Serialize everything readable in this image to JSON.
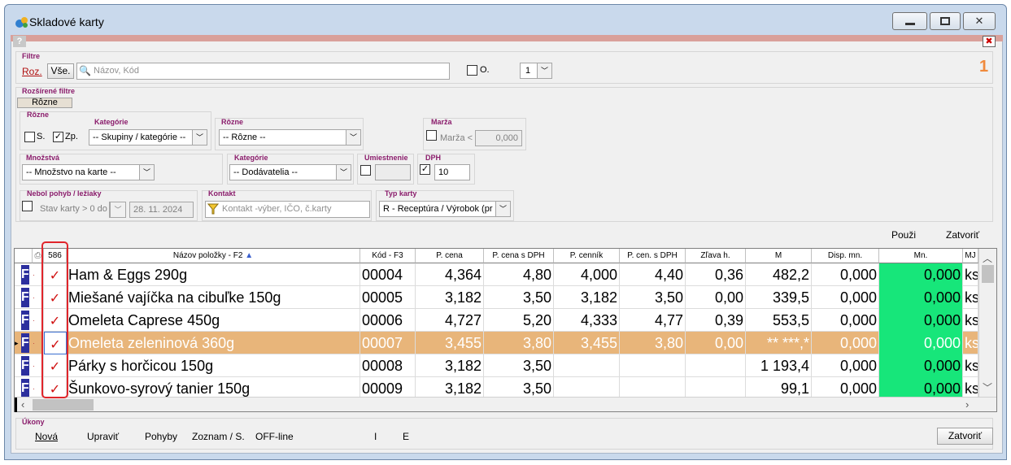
{
  "window": {
    "title": "Skladové karty"
  },
  "filters": {
    "label": "Filtre",
    "roz": "Roz.",
    "vse": "Vše.",
    "search_placeholder": "Názov, Kód",
    "o_label": "O.",
    "page_select": "1",
    "badge": "1"
  },
  "extended": {
    "label": "Rozšírené filtre",
    "tab": "Rôzne",
    "rozne_group": "Rôzne",
    "s_label": "S.",
    "zp_label": "Zp.",
    "kategorie1_label": "Kategórie",
    "kategorie1_value": "-- Skupiny / kategórie --",
    "rozne2_label": "Rôzne",
    "rozne2_value": "-- Rôzne --",
    "marza_label": "Marža",
    "marza_text": "Marža <",
    "marza_value": "0,000",
    "mnozstvo_label": "Množstvá",
    "mnozstvo_value": "-- Množstvo na karte --",
    "kategorie2_label": "Kategórie",
    "kategorie2_value": "-- Dodávatelia --",
    "umiestnenie_label": "Umiestnenie",
    "dph_label": "DPH",
    "dph_value": "10",
    "nebol_label": "Nebol pohyb / ležiaky",
    "stav_text": "Stav karty > 0 do",
    "date_value": "28. 11. 2024",
    "kontakt_label": "Kontakt",
    "kontakt_placeholder": "Kontakt -výber, IČO, č.karty",
    "typ_label": "Typ karty",
    "typ_value": "R - Receptúra / Výrobok (pr",
    "pouzi": "Použi",
    "zatvorit": "Zatvoriť"
  },
  "grid": {
    "headers": {
      "count": "586",
      "nazov": "Názov položky - F2",
      "kod": "Kód - F3",
      "pcena": "P. cena",
      "pcena_dph": "P. cena s DPH",
      "pcennik": "P. cenník",
      "pcen_dph": "P. cen. s DPH",
      "zlava": "Zľava h.",
      "m": "M",
      "disp": "Disp. mn.",
      "mn": "Mn.",
      "mj": "MJ"
    },
    "rows": [
      {
        "tag": "F",
        "name": "Ham & Eggs  290g",
        "kod": "00004",
        "pcena": "4,364",
        "pcena_dph": "4,80",
        "pcennik": "4,000",
        "pcen_dph": "4,40",
        "zlava": "0,36",
        "m": "482,2",
        "disp": "0,000",
        "mn": "0,000",
        "mj": "ks"
      },
      {
        "tag": "F",
        "name": "Miešané vajíčka na cibuľke 150g",
        "kod": "00005",
        "pcena": "3,182",
        "pcena_dph": "3,50",
        "pcennik": "3,182",
        "pcen_dph": "3,50",
        "zlava": "0,00",
        "m": "339,5",
        "disp": "0,000",
        "mn": "0,000",
        "mj": "ks"
      },
      {
        "tag": "F",
        "name": "Omeleta Caprese 450g",
        "kod": "00006",
        "pcena": "4,727",
        "pcena_dph": "5,20",
        "pcennik": "4,333",
        "pcen_dph": "4,77",
        "zlava": "0,39",
        "m": "553,5",
        "disp": "0,000",
        "mn": "0,000",
        "mj": "ks"
      },
      {
        "tag": "F",
        "name": "Omeleta zeleninová 360g",
        "kod": "00007",
        "pcena": "3,455",
        "pcena_dph": "3,80",
        "pcennik": "3,455",
        "pcen_dph": "3,80",
        "zlava": "0,00",
        "m": "** ***,*",
        "disp": "0,000",
        "mn": "0,000",
        "mj": "ks"
      },
      {
        "tag": "F",
        "name": "Párky s horčicou 150g",
        "kod": "00008",
        "pcena": "3,182",
        "pcena_dph": "3,50",
        "pcennik": "",
        "pcen_dph": "",
        "zlava": "",
        "m": "1 193,4",
        "disp": "0,000",
        "mn": "0,000",
        "mj": "ks"
      },
      {
        "tag": "F",
        "name": "Šunkovo-syrový tanier 150g",
        "kod": "00009",
        "pcena": "3,182",
        "pcena_dph": "3,50",
        "pcennik": "",
        "pcen_dph": "",
        "zlava": "",
        "m": "99,1",
        "disp": "0,000",
        "mn": "0,000",
        "mj": "ks"
      }
    ]
  },
  "ukony": {
    "label": "Úkony",
    "nova": "Nová",
    "upravit": "Upraviť",
    "pohyby": "Pohyby",
    "zoznam": "Zoznam / S.",
    "offline": "OFF-line",
    "i": "I",
    "e": "E",
    "zatvorit": "Zatvoriť"
  },
  "colors": {
    "selected_row": "#e8b57a",
    "green": "#17e67a",
    "tag": "#2c2f9e",
    "annotation": "#e0252b"
  }
}
